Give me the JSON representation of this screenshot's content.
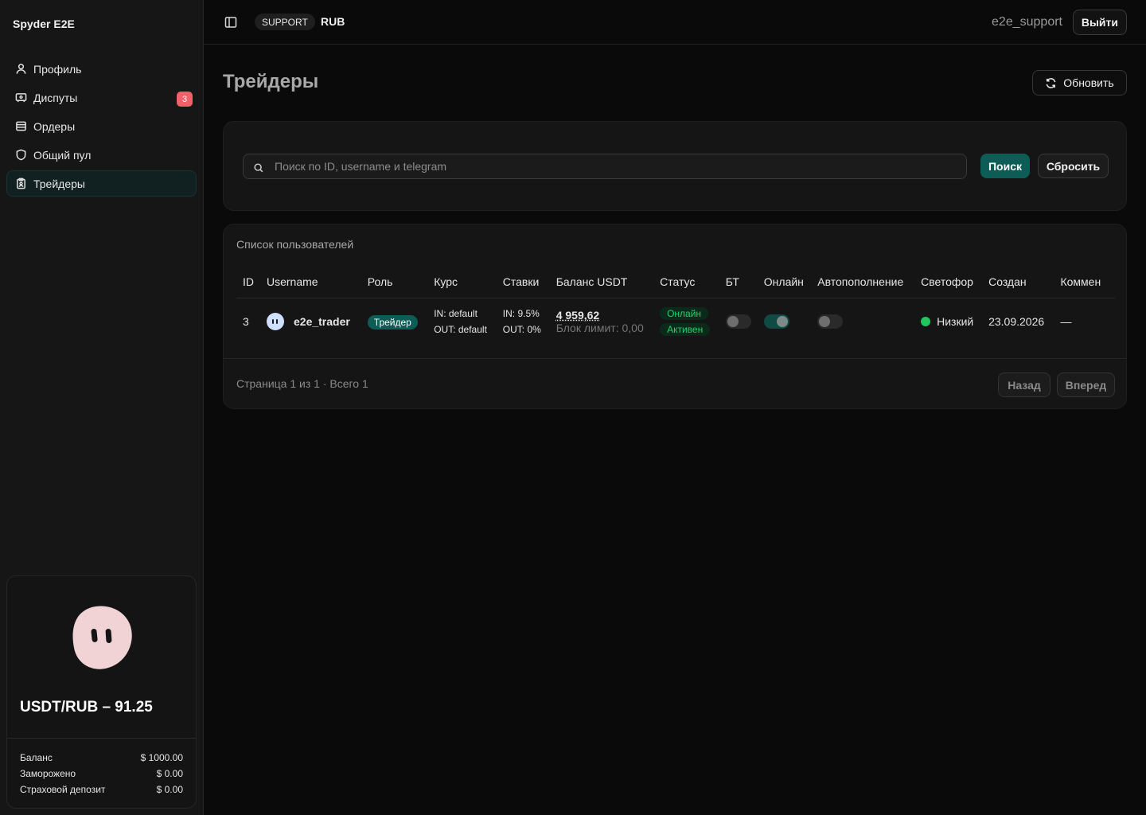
{
  "app": {
    "brand": "Spyder E2E"
  },
  "sidebar": {
    "items": [
      {
        "label": "Профиль",
        "icon": "user-icon"
      },
      {
        "label": "Диспуты",
        "icon": "ticket-icon",
        "badge": "3"
      },
      {
        "label": "Ордеры",
        "icon": "wallet-icon"
      },
      {
        "label": "Общий пул",
        "icon": "shield-icon"
      },
      {
        "label": "Трейдеры",
        "icon": "clipboard-icon",
        "active": true
      }
    ],
    "wallet": {
      "rate": "USDT/RUB – 91.25",
      "rows": [
        {
          "label": "Баланс",
          "value": "$ 1000.00"
        },
        {
          "label": "Заморожено",
          "value": "$ 0.00"
        },
        {
          "label": "Страховой депозит",
          "value": "$ 0.00"
        }
      ]
    }
  },
  "header": {
    "role": "SUPPORT",
    "currency": "RUB",
    "username": "e2e_support",
    "logout_label": "Выйти"
  },
  "main": {
    "title": "Трейдеры",
    "refresh_label": "Обновить",
    "search": {
      "placeholder": "Поиск по ID, username и telegram",
      "value": "",
      "search_label": "Поиск",
      "reset_label": "Сбросить"
    },
    "list": {
      "title": "Список пользователей",
      "columns": [
        "ID",
        "Username",
        "Роль",
        "Курс",
        "Ставки",
        "Баланс USDT",
        "Статус",
        "БТ",
        "Онлайн",
        "Автопополнение",
        "Светофор",
        "Создан",
        "Коммен"
      ],
      "rows": [
        {
          "id": "3",
          "username": "e2e_trader",
          "role": "Трейдер",
          "rate_in": "IN: default",
          "rate_out": "OUT: default",
          "fee_in": "IN: 9.5%",
          "fee_out": "OUT: 0%",
          "balance": "4 959,62",
          "block_limit": "Блок лимит: 0,00",
          "status_online": "Онлайн",
          "status_active": "Активен",
          "bt": false,
          "online": true,
          "autotopup": false,
          "traffic": "Низкий",
          "traffic_color": "#22c55e",
          "created": "23.09.2026",
          "comment": "—"
        }
      ]
    },
    "pagination": {
      "text": "Страница 1 из 1 · Всего 1",
      "prev_label": "Назад",
      "next_label": "Вперед"
    }
  },
  "colors": {
    "accent": "#0d5c56",
    "badge_red": "#f4606a",
    "status_green": "#2ecc71"
  }
}
